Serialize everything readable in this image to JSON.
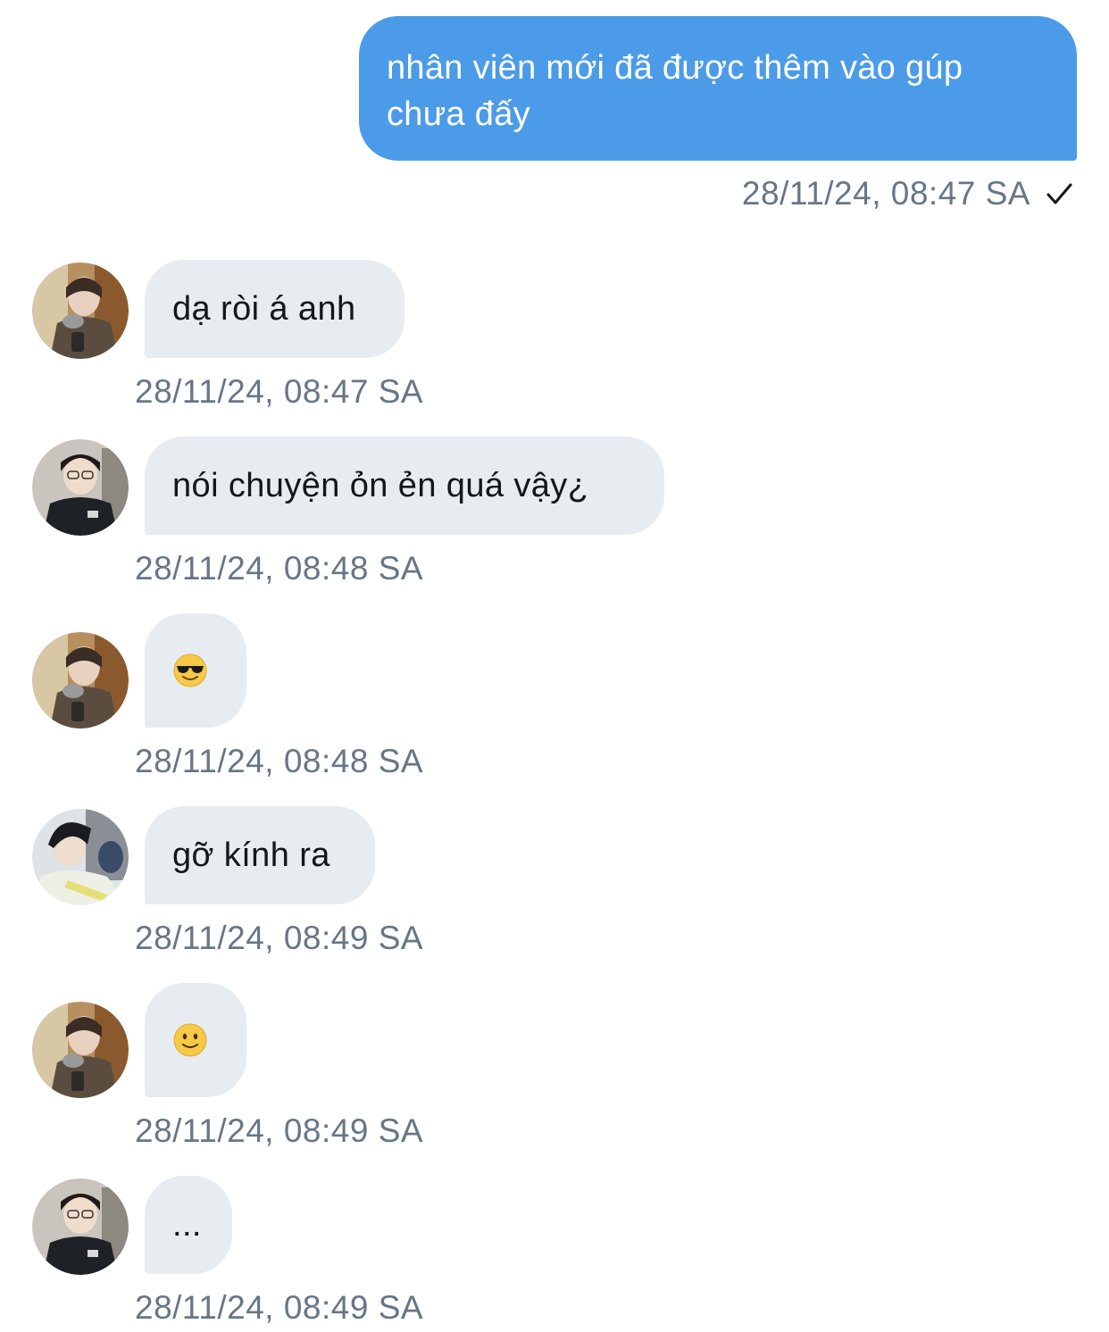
{
  "outgoing": {
    "text": "nhân viên mới đã được thêm vào gúp chưa đấy",
    "timestamp": "28/11/24, 08:47 SA",
    "status_icon": "check-icon"
  },
  "messages": [
    {
      "avatar": "avatar-person-a",
      "text": "dạ ròi á anh",
      "timestamp": "28/11/24, 08:47 SA"
    },
    {
      "avatar": "avatar-person-b",
      "text": "nói chuyện ỏn ẻn quá vậy¿",
      "timestamp": "28/11/24, 08:48 SA"
    },
    {
      "avatar": "avatar-person-a",
      "emoji": "smiling-face-with-sunglasses-icon",
      "timestamp": "28/11/24, 08:48 SA"
    },
    {
      "avatar": "avatar-person-c",
      "text": "gỡ kính ra",
      "timestamp": "28/11/24, 08:49 SA"
    },
    {
      "avatar": "avatar-person-a",
      "emoji": "slightly-smiling-face-icon",
      "timestamp": "28/11/24, 08:49 SA"
    },
    {
      "avatar": "avatar-person-b",
      "text": "...",
      "timestamp": "28/11/24, 08:49 SA"
    }
  ],
  "colors": {
    "outgoing_bubble": "#4c9be8",
    "incoming_bubble": "#e6ecf0",
    "timestamp": "#657786",
    "text": "#14171a"
  }
}
